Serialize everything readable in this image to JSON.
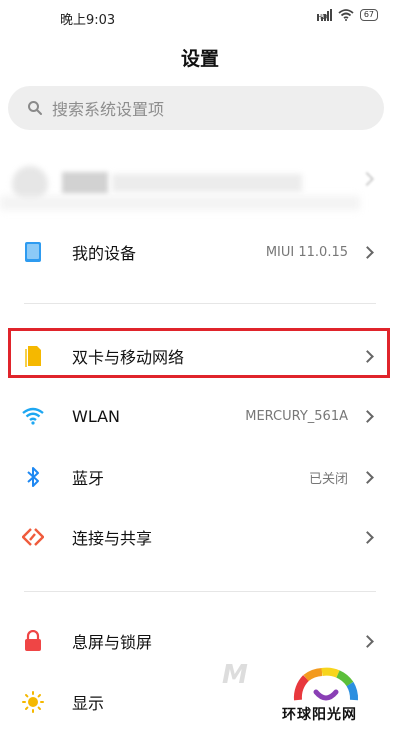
{
  "status_bar": {
    "time": "晚上9:03",
    "battery": "67"
  },
  "header": {
    "title": "设置"
  },
  "search": {
    "placeholder": "搜索系统设置项"
  },
  "rows": [
    {
      "label": "我的设备",
      "value": "MIUI 11.0.15",
      "icon": "device-icon",
      "color": "#2e9bf0"
    },
    {
      "label": "双卡与移动网络",
      "value": "",
      "icon": "sim-card-icon",
      "color": "#f5b800"
    },
    {
      "label": "WLAN",
      "value": "MERCURY_561A",
      "icon": "wifi-icon",
      "color": "#1ea7f2"
    },
    {
      "label": "蓝牙",
      "value": "已关闭",
      "icon": "bluetooth-icon",
      "color": "#1e88f2"
    },
    {
      "label": "连接与共享",
      "value": "",
      "icon": "connection-share-icon",
      "color": "#ef5b3c"
    },
    {
      "label": "息屏与锁屏",
      "value": "",
      "icon": "lock-icon",
      "color": "#ef4545"
    },
    {
      "label": "显示",
      "value": "",
      "icon": "sun-icon",
      "color": "#f5b800"
    }
  ],
  "highlight_color": "#e0242b",
  "watermark": {
    "mark": "M",
    "text": "环球阳光网"
  }
}
